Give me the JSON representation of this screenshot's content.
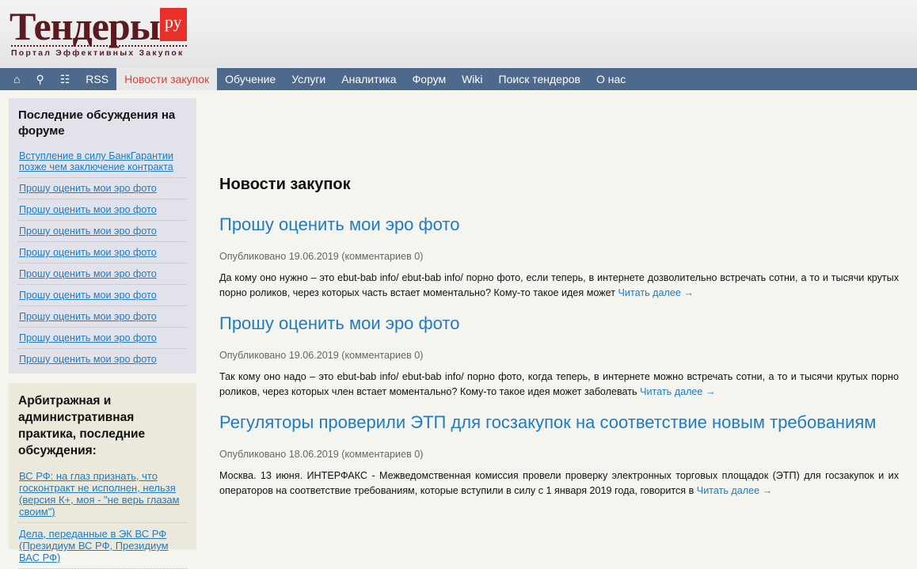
{
  "logo": {
    "word": "Тендеры",
    "ru": "ру",
    "tagline": "Портал Эффективных Закупок"
  },
  "nav": {
    "icons": [
      "home-icon",
      "search-icon",
      "sitemap-icon"
    ],
    "items": [
      "RSS",
      "Новости закупок",
      "Обучение",
      "Услуги",
      "Аналитика",
      "Форум",
      "Wiki",
      "Поиск тендеров",
      "О нас"
    ]
  },
  "sidebar1": {
    "title": "Последние обсуждения на форуме",
    "links": [
      "Вступление в силу БанкГарантии позже чем заключение контракта",
      "Прошу оценить мои эро фото",
      "Прошу оценить мои эро фото",
      "Прошу оценить мои эро фото",
      "Прошу оценить мои эро фото",
      "Прошу оценить мои эро фото",
      "Прошу оценить мои эро фото",
      "Прошу оценить мои эро фото",
      "Прошу оценить мои эро фото",
      "Прошу оценить мои эро фото"
    ]
  },
  "sidebar2": {
    "title": "Арбитражная и административная практика, последние обсуждения:",
    "links": [
      "ВС РФ: на глаз признать, что госконтракт не исполнен, нельзя (версия К+, моя - \"не верь глазам своим\")",
      "Дела, переданные в ЭК ВС РФ (Президиум ВС РФ, Президиум ВАС РФ)"
    ]
  },
  "main": {
    "title": "Новости закупок",
    "read_more": "Читать далее →",
    "articles": [
      {
        "title": "Прошу оценить мои эро фото",
        "meta": "Опубликовано 19.06.2019 (комментариев 0)",
        "text": "Да кому оно нужно – это ebut-bab info/ ebut-bab info/ порно фото, если теперь, в интернете дозволительно встречать сотни, а то и тысячи крутых порно роликов, через которых часть встает моментально? Кому-то такое идея может"
      },
      {
        "title": "Прошу оценить мои эро фото",
        "meta": "Опубликовано 19.06.2019 (комментариев 0)",
        "text": "Так кому оно надо – это ebut-bab info/ ebut-bab info/ порно фото, когда теперь, в интернете можно встречать сотни, а то и тысячи крутых порно роликов, через которых член встает моментально? Кому-то такое идея может заболевать"
      },
      {
        "title": "Регуляторы проверили ЭТП для госзакупок на соответствие новым требованиям",
        "meta": "Опубликовано 18.06.2019 (комментариев 0)",
        "text": "Москва. 13 июня. ИНТЕРФАКС - Межведомственная комиссия провели проверку электронных торговых площадок (ЭТП) для госзакупок и их операторов на соответствие требованиям, которые вступили в силу с 1 января 2019 года, говорится в"
      }
    ]
  }
}
